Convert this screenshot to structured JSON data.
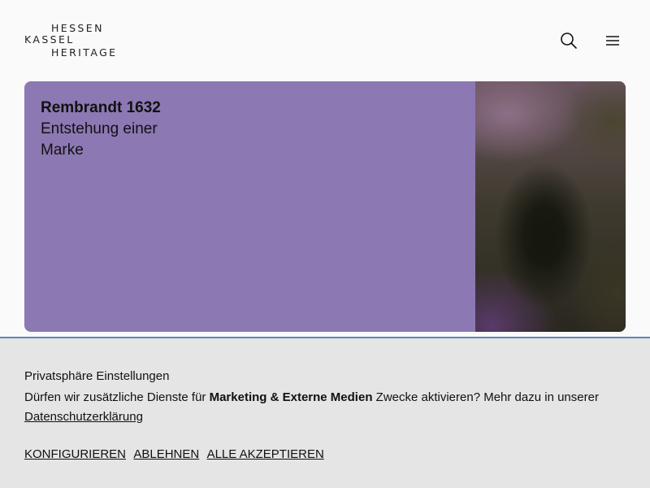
{
  "header": {
    "logo": {
      "line1": "HESSEN",
      "line2": "KASSEL",
      "line3": "HERITAGE"
    },
    "search_icon": "search-icon",
    "menu_icon": "hamburger-menu-icon"
  },
  "card": {
    "title": "Rembrandt 1632",
    "subtitle": "Entstehung einer Marke",
    "background_color": "#8c78b3"
  },
  "cookie_banner": {
    "title": "Privatsphäre Einstellungen",
    "text_before": "Dürfen wir zusätzliche Dienste für ",
    "text_bold": "Marketing & Externe Medien",
    "text_after": " Zwecke aktivieren? Mehr dazu in unserer ",
    "privacy_link": "Datenschutzerklärung",
    "buttons": {
      "configure": "KONFIGURIEREN",
      "reject": "ABLEHNEN",
      "accept_all": "ALLE AKZEPTIEREN"
    },
    "border_color": "#5a87c0"
  }
}
